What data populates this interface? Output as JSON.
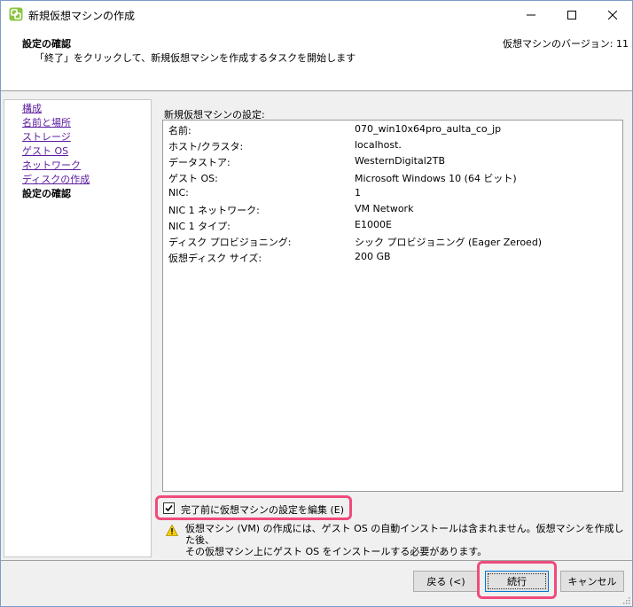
{
  "window": {
    "title": "新規仮想マシンの作成",
    "controls": {
      "minimize": "minimize",
      "maximize": "maximize",
      "close": "close"
    }
  },
  "header": {
    "title": "設定の確認",
    "subtitle": "「終了」をクリックして、新規仮想マシンを作成するタスクを開始します",
    "version": "仮想マシンのバージョン: 11"
  },
  "nav": {
    "items": [
      {
        "label": "構成",
        "state": "link"
      },
      {
        "label": "名前と場所",
        "state": "link"
      },
      {
        "label": "ストレージ",
        "state": "link"
      },
      {
        "label": "ゲスト OS",
        "state": "link"
      },
      {
        "label": "ネットワーク",
        "state": "link"
      },
      {
        "label": "ディスクの作成",
        "state": "link"
      },
      {
        "label": "設定の確認",
        "state": "current"
      }
    ]
  },
  "settings": {
    "caption": "新規仮想マシンの設定:",
    "rows": [
      {
        "key": "名前:",
        "value": "070_win10x64pro_aulta_co_jp"
      },
      {
        "key": "ホスト/クラスタ:",
        "value": "localhost."
      },
      {
        "key": "データストア:",
        "value": "WesternDigital2TB"
      },
      {
        "key": "ゲスト OS:",
        "value": "Microsoft Windows 10 (64 ビット)"
      },
      {
        "key": "NIC:",
        "value": "1"
      },
      {
        "key": "NIC 1 ネットワーク:",
        "value": "VM Network"
      },
      {
        "key": "NIC 1 タイプ:",
        "value": "E1000E"
      },
      {
        "key": "ディスク プロビジョニング:",
        "value": "シック プロビジョニング (Eager Zeroed)"
      },
      {
        "key": "仮想ディスク サイズ:",
        "value": "200 GB"
      }
    ]
  },
  "edit_checkbox": {
    "label": "完了前に仮想マシンの設定を編集 (E)",
    "checked": true
  },
  "warning": {
    "line1": "仮想マシン (VM) の作成には、ゲスト OS の自動インストールは含まれません。仮想マシンを作成した後、",
    "line2": "その仮想マシン上にゲスト OS をインストールする必要があります。"
  },
  "buttons": {
    "back": "戻る (<)",
    "next": "続行",
    "cancel": "キャンセル"
  },
  "colors": {
    "highlight": "#ef4b7b",
    "link": "#5a1a9e",
    "focus": "#0078d7"
  }
}
